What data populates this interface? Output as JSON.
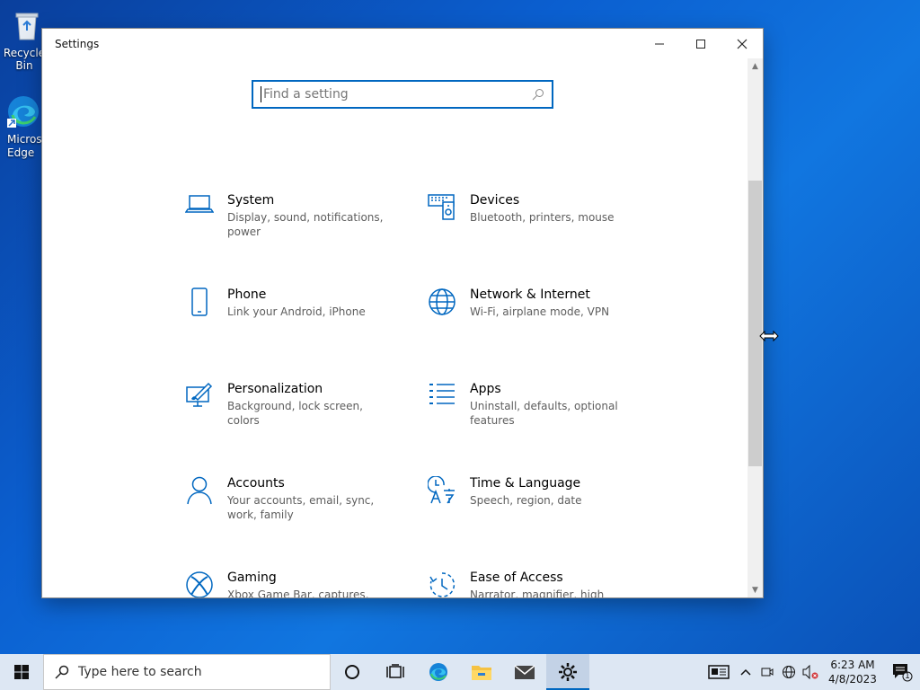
{
  "desktop": {
    "icons": [
      {
        "label": "Recycle Bin"
      },
      {
        "label": "Microsoft Edge"
      }
    ]
  },
  "window": {
    "title": "Settings",
    "search_placeholder": "Find a setting"
  },
  "settings": [
    {
      "name": "System",
      "desc": "Display, sound, notifications, power",
      "icon": "laptop-icon"
    },
    {
      "name": "Devices",
      "desc": "Bluetooth, printers, mouse",
      "icon": "devices-icon"
    },
    {
      "name": "Phone",
      "desc": "Link your Android, iPhone",
      "icon": "phone-icon"
    },
    {
      "name": "Network & Internet",
      "desc": "Wi-Fi, airplane mode, VPN",
      "icon": "globe-icon"
    },
    {
      "name": "Personalization",
      "desc": "Background, lock screen, colors",
      "icon": "paint-icon"
    },
    {
      "name": "Apps",
      "desc": "Uninstall, defaults, optional features",
      "icon": "apps-list-icon"
    },
    {
      "name": "Accounts",
      "desc": "Your accounts, email, sync, work, family",
      "icon": "person-icon"
    },
    {
      "name": "Time & Language",
      "desc": "Speech, region, date",
      "icon": "time-language-icon"
    },
    {
      "name": "Gaming",
      "desc": "Xbox Game Bar, captures, Game Mode",
      "icon": "xbox-icon"
    },
    {
      "name": "Ease of Access",
      "desc": "Narrator, magnifier, high contrast",
      "icon": "ease-of-access-icon"
    }
  ],
  "taskbar": {
    "search_label": "Type here to search",
    "time": "6:23 AM",
    "date": "4/8/2023",
    "notification_count": "1"
  },
  "colors": {
    "accent": "#0067c0",
    "taskbar": "#dde7f3"
  }
}
